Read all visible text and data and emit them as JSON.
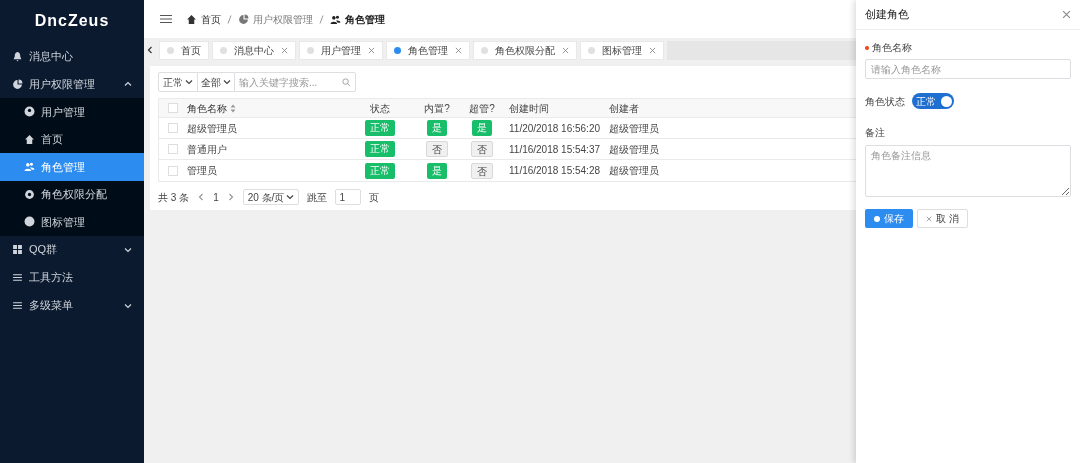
{
  "sidebar": {
    "logo": "DncZeus",
    "items": [
      {
        "label": "消息中心",
        "selected": false
      },
      {
        "label": "用户权限管理",
        "selected": false,
        "expanded": true,
        "children": [
          {
            "label": "用户管理",
            "selected": false
          },
          {
            "label": "首页",
            "selected": false
          },
          {
            "label": "角色管理",
            "selected": true
          },
          {
            "label": "角色权限分配",
            "selected": false
          },
          {
            "label": "图标管理",
            "selected": false
          }
        ]
      },
      {
        "label": "QQ群",
        "selected": false,
        "expanded": false
      },
      {
        "label": "工具方法",
        "selected": false
      },
      {
        "label": "多级菜单",
        "selected": false,
        "expanded": false
      }
    ]
  },
  "breadcrumb": [
    {
      "label": "首页"
    },
    {
      "label": "用户权限管理"
    },
    {
      "label": "角色管理"
    }
  ],
  "tabs": [
    {
      "label": "首页",
      "selected": false,
      "closable": false
    },
    {
      "label": "消息中心",
      "selected": false,
      "closable": true
    },
    {
      "label": "用户管理",
      "selected": false,
      "closable": true
    },
    {
      "label": "角色管理",
      "selected": true,
      "closable": true
    },
    {
      "label": "角色权限分配",
      "selected": false,
      "closable": true
    },
    {
      "label": "图标管理",
      "selected": false,
      "closable": true
    }
  ],
  "toolbar": {
    "status_filter": "正常",
    "type_filter": "全部",
    "search": {
      "placeholder": "输入关键字搜索..."
    }
  },
  "table": {
    "select_all_checked": false,
    "columns": [
      "角色名称",
      "状态",
      "内置?",
      "超管?",
      "创建时间",
      "创建者"
    ],
    "rows": [
      {
        "checked": false,
        "name": "超级管理员",
        "status": "正常",
        "builtin": {
          "text": "是",
          "on": true
        },
        "superadmin": {
          "text": "是",
          "on": true
        },
        "created": "11/20/2018 16:56:20",
        "creator": "超级管理员"
      },
      {
        "checked": false,
        "name": "普通用户",
        "status": "正常",
        "builtin": {
          "text": "否",
          "on": false
        },
        "superadmin": {
          "text": "否",
          "on": false
        },
        "created": "11/16/2018 15:54:37",
        "creator": "超级管理员"
      },
      {
        "checked": false,
        "name": "管理员",
        "status": "正常",
        "builtin": {
          "text": "是",
          "on": true
        },
        "superadmin": {
          "text": "否",
          "on": false
        },
        "created": "11/16/2018 15:54:28",
        "creator": "超级管理员"
      }
    ]
  },
  "pagination": {
    "total": "共 3 条",
    "page": "1",
    "page_size": "20 条/页",
    "jump_label": "跳至",
    "jump_value": "1",
    "page_suffix": "页"
  },
  "drawer": {
    "title": "创建角色",
    "name_label": "角色名称",
    "name_required": true,
    "name_placeholder": "请输入角色名称",
    "status_label": "角色状态",
    "status_switch": {
      "text": "正常",
      "on": true
    },
    "note_label": "备注",
    "note_placeholder": "角色备注信息",
    "save": "保存",
    "cancel": "取 消"
  }
}
